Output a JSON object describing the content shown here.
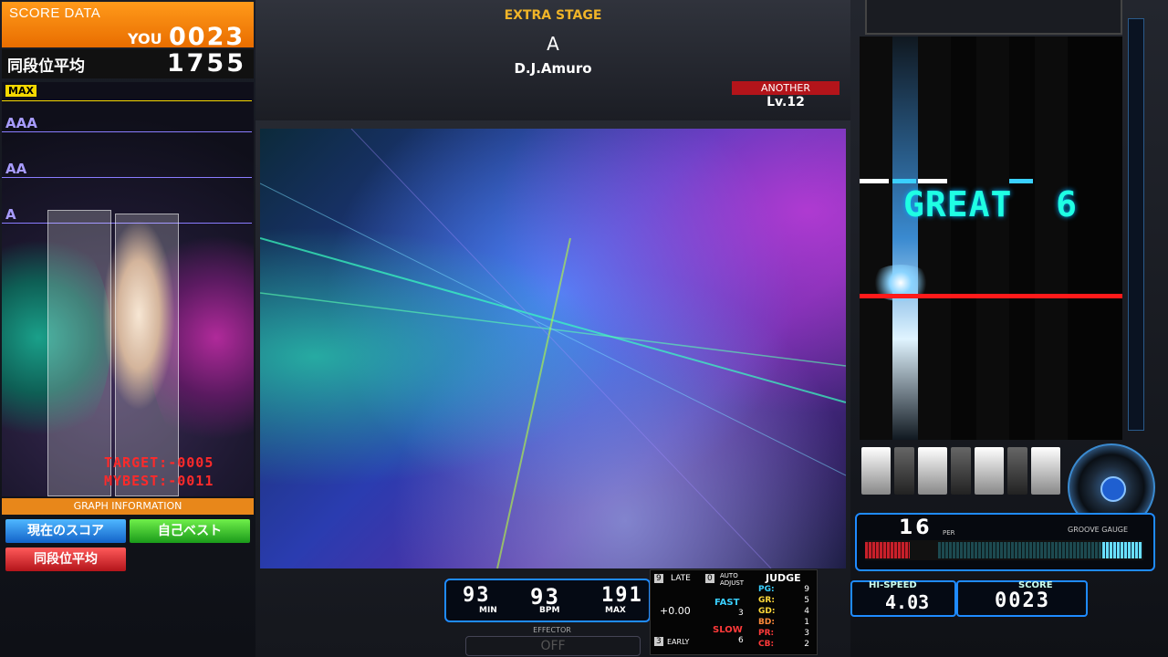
{
  "score_panel": {
    "title": "SCORE DATA",
    "you_label": "YOU",
    "you_score": "0023",
    "avg_label": "同段位平均",
    "avg_score": "1755",
    "grades": [
      "MAX",
      "AAA",
      "AA",
      "A"
    ],
    "target_text": "TARGET:-0005",
    "mybest_text": "MYBEST:-0011",
    "graph_info": "GRAPH INFORMATION",
    "buttons": [
      "現在のスコア",
      "自己ベスト",
      "同段位平均"
    ]
  },
  "song": {
    "stage": "EXTRA STAGE",
    "title": "A",
    "artist": "D.J.Amuro",
    "difficulty": "ANOTHER",
    "level": "Lv.12"
  },
  "bpm": {
    "min": "93",
    "current": "93",
    "max": "191",
    "min_label": "MIN",
    "bpm_label": "BPM",
    "max_label": "MAX"
  },
  "effector": {
    "label": "EFFECTOR",
    "value": "OFF"
  },
  "judge": {
    "late_key": "9",
    "late_label": "LATE",
    "auto_key": "0",
    "auto_label": "AUTO ADJUST",
    "early_key": "3",
    "early_label": "EARLY",
    "offset": "+0.00",
    "fast_label": "FAST",
    "fast": "3",
    "slow_label": "SLOW",
    "slow": "6",
    "title": "JUDGE",
    "rows": [
      {
        "k": "PG:",
        "v": "9",
        "color": "#3ad0ff"
      },
      {
        "k": "GR:",
        "v": "5",
        "color": "#ffd93a"
      },
      {
        "k": "GD:",
        "v": "4",
        "color": "#ffd93a"
      },
      {
        "k": "BD:",
        "v": "1",
        "color": "#ff8a3a"
      },
      {
        "k": "PR:",
        "v": "3",
        "color": "#ff3a3a"
      },
      {
        "k": "CB:",
        "v": "2",
        "color": "#ff3a3a"
      }
    ]
  },
  "playfield": {
    "judge_text": "GREAT",
    "combo": "6"
  },
  "gauge": {
    "value": "16",
    "per": "PER",
    "label": "GROOVE GAUGE",
    "fill": 0.16
  },
  "hispeed": {
    "label": "HI-SPEED",
    "value": "4.03"
  },
  "score": {
    "label": "SCORE",
    "value": "0023"
  },
  "colors": {
    "accent": "#1f8bff",
    "orange": "#f08a1a",
    "great": "#1fffe3"
  }
}
